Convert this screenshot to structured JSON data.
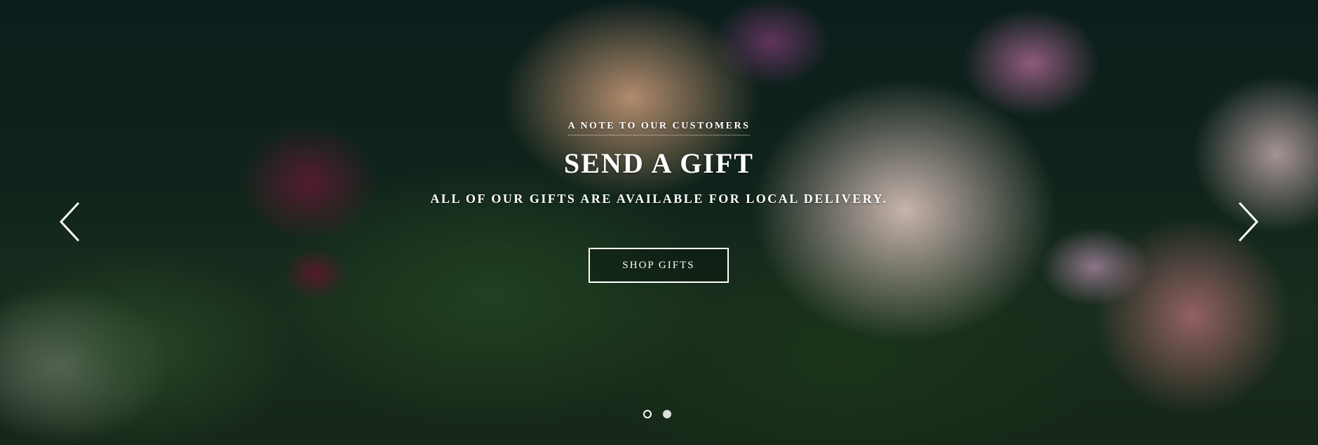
{
  "slider": {
    "eyebrow": "A NOTE TO OUR CUSTOMERS",
    "title": "SEND A GIFT",
    "subtitle": "ALL OF OUR GIFTS ARE AVAILABLE FOR LOCAL DELIVERY.",
    "cta_label": "SHOP GIFTS",
    "prev_icon": "chevron-left-icon",
    "next_icon": "chevron-right-icon",
    "slide_count": 2,
    "active_slide": 1
  },
  "colors": {
    "text": "#ffffff",
    "background": "#13291f"
  }
}
